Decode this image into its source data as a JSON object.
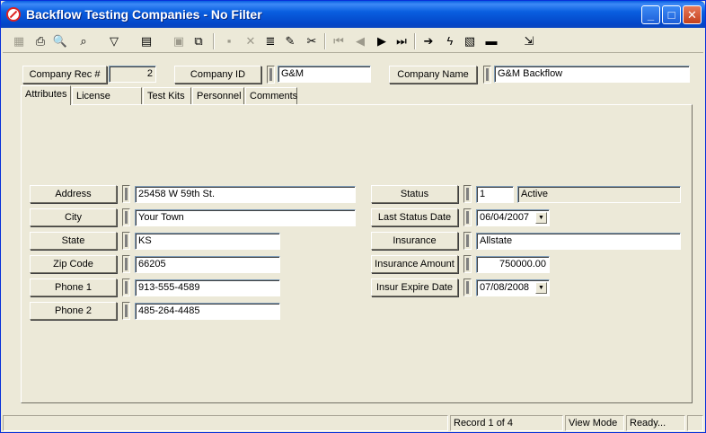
{
  "window": {
    "title": "Backflow Testing Companies - No Filter",
    "controls": {
      "minimize": "_",
      "maximize": "□",
      "close": "✕"
    }
  },
  "toolbar": [
    {
      "name": "grid-icon",
      "glyph": "▦",
      "enabled": false
    },
    {
      "name": "print-icon",
      "glyph": "⎙",
      "enabled": true
    },
    {
      "name": "print-preview-icon",
      "glyph": "🔍",
      "enabled": true
    },
    {
      "name": "binoculars-icon",
      "glyph": "⌕",
      "enabled": true
    },
    {
      "name": "filter-icon",
      "glyph": "▽",
      "enabled": true
    },
    {
      "name": "form-icon",
      "glyph": "▤",
      "enabled": true
    },
    {
      "name": "properties-icon",
      "glyph": "▣",
      "enabled": false
    },
    {
      "name": "copy-record-icon",
      "glyph": "⧉",
      "enabled": true
    },
    {
      "name": "save-icon",
      "glyph": "▪",
      "enabled": false
    },
    {
      "name": "delete-icon",
      "glyph": "✕",
      "enabled": false
    },
    {
      "name": "books-icon",
      "glyph": "≣",
      "enabled": true
    },
    {
      "name": "edit-pencil-icon",
      "glyph": "✎",
      "enabled": true
    },
    {
      "name": "cut-icon",
      "glyph": "✂",
      "enabled": true
    },
    {
      "name": "first-record-icon",
      "glyph": "⏮",
      "enabled": false
    },
    {
      "name": "previous-record-icon",
      "glyph": "◀",
      "enabled": false
    },
    {
      "name": "next-record-icon",
      "glyph": "▶",
      "enabled": true
    },
    {
      "name": "last-record-icon",
      "glyph": "⏭",
      "enabled": true
    },
    {
      "name": "go-to-icon",
      "glyph": "➔",
      "enabled": true
    },
    {
      "name": "lightning-icon",
      "glyph": "ϟ",
      "enabled": true
    },
    {
      "name": "report-icon",
      "glyph": "▧",
      "enabled": true
    },
    {
      "name": "book-icon",
      "glyph": "▬",
      "enabled": true
    },
    {
      "name": "exit-icon",
      "glyph": "⇲",
      "enabled": true
    }
  ],
  "header": {
    "company_rec_label": "Company Rec #",
    "company_rec_value": "2",
    "company_id_label": "Company ID",
    "company_id_value": "G&M",
    "company_name_label": "Company Name",
    "company_name_value": "G&M Backflow"
  },
  "tabs": [
    {
      "label": "Attributes",
      "active": true
    },
    {
      "label": "License Types",
      "active": false
    },
    {
      "label": "Test Kits",
      "active": false
    },
    {
      "label": "Personnel",
      "active": false
    },
    {
      "label": "Comments",
      "active": false
    }
  ],
  "left_fields": [
    {
      "label": "Address",
      "value": "25458 W 59th St."
    },
    {
      "label": "City",
      "value": "Your Town"
    },
    {
      "label": "State",
      "value": "KS"
    },
    {
      "label": "Zip Code",
      "value": "66205"
    },
    {
      "label": "Phone 1",
      "value": "913-555-4589"
    },
    {
      "label": "Phone 2",
      "value": "485-264-4485"
    }
  ],
  "right_fields": {
    "status": {
      "label": "Status",
      "code": "1",
      "text": "Active"
    },
    "last_status_date": {
      "label": "Last Status Date",
      "value": "06/04/2007"
    },
    "insurance": {
      "label": "Insurance",
      "value": "Allstate"
    },
    "insurance_amount": {
      "label": "Insurance Amount",
      "value": "750000.00"
    },
    "insur_expire_date": {
      "label": "Insur Expire Date",
      "value": "07/08/2008"
    }
  },
  "status_bar": {
    "record": "Record 1 of 4",
    "mode": "View Mode",
    "state": "Ready..."
  }
}
